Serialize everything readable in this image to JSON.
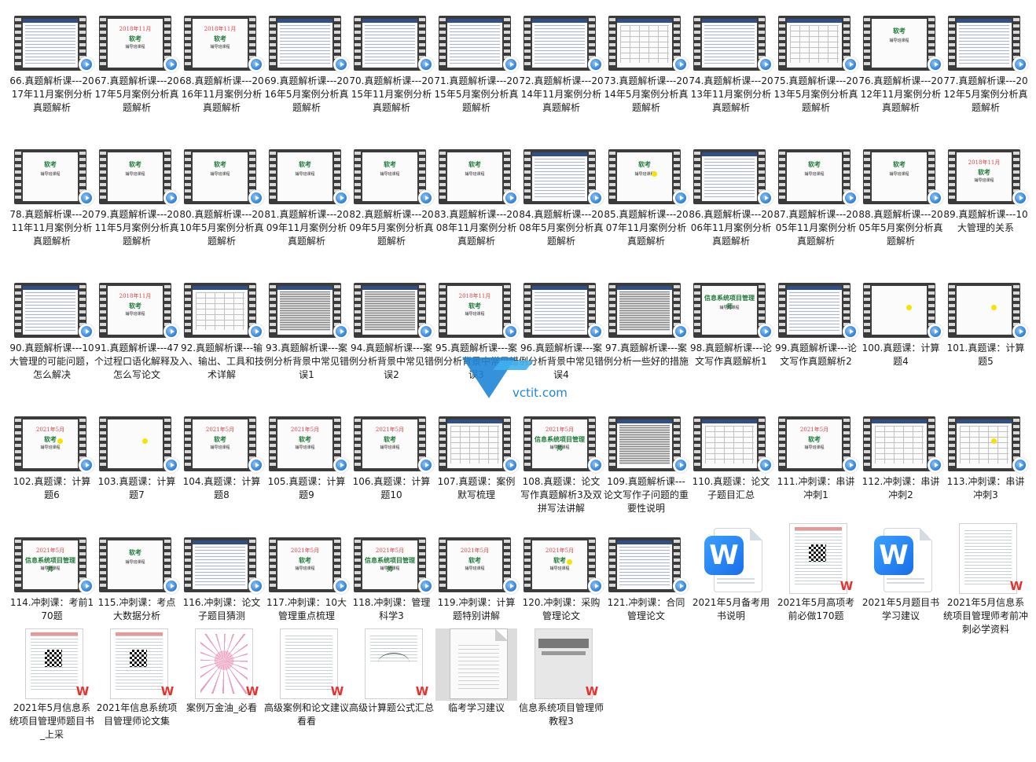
{
  "items": [
    {
      "label": "66.真题解析课---2017年11月案例分析真题解析",
      "thumb": "video",
      "screen": "lines"
    },
    {
      "label": "67.真题解析课---2017年5月案例分析真题解析",
      "thumb": "video",
      "screen": "title",
      "red": "2018年11月",
      "green": "软考",
      "small": "辅导班课程"
    },
    {
      "label": "68.真题解析课---2016年11月案例分析真题解析",
      "thumb": "video",
      "screen": "title",
      "red": "2018年11月",
      "green": "软考",
      "small": "辅导班课程"
    },
    {
      "label": "69.真题解析课---2016年5月案例分析真题解析",
      "thumb": "video",
      "screen": "lines"
    },
    {
      "label": "70.真题解析课---2015年11月案例分析真题解析",
      "thumb": "video",
      "screen": "lines"
    },
    {
      "label": "71.真题解析课---2015年5月案例分析真题解析",
      "thumb": "video",
      "screen": "lines"
    },
    {
      "label": "72.真题解析课---2014年11月案例分析真题解析",
      "thumb": "video",
      "screen": "lines"
    },
    {
      "label": "73.真题解析课---2014年5月案例分析真题解析",
      "thumb": "video",
      "screen": "table"
    },
    {
      "label": "74.真题解析课---2013年11月案例分析真题解析",
      "thumb": "video",
      "screen": "lines"
    },
    {
      "label": "75.真题解析课---2013年5月案例分析真题解析",
      "thumb": "video",
      "screen": "table"
    },
    {
      "label": "76.真题解析课---2012年11月案例分析真题解析",
      "thumb": "video",
      "screen": "title",
      "green": "软考",
      "small": "辅导班课程"
    },
    {
      "label": "77.真题解析课---2012年5月案例分析真题解析",
      "thumb": "video",
      "screen": "lines"
    },
    {
      "label": "78.真题解析课---2011年11月案例分析真题解析",
      "thumb": "video",
      "screen": "title",
      "green": "软考",
      "small": "辅导班课程"
    },
    {
      "label": "79.真题解析课---2011年5月案例分析真题解析",
      "thumb": "video",
      "screen": "title",
      "green": "软考",
      "small": "辅导班课程"
    },
    {
      "label": "80.真题解析课---2010年5月案例分析真题解析",
      "thumb": "video",
      "screen": "title",
      "green": "软考",
      "small": "辅导班课程"
    },
    {
      "label": "81.真题解析课---2009年11月案例分析真题解析",
      "thumb": "video",
      "screen": "title",
      "green": "软考",
      "small": "辅导班课程"
    },
    {
      "label": "82.真题解析课---2009年5月案例分析真题解析",
      "thumb": "video",
      "screen": "title",
      "green": "软考",
      "small": "辅导班课程"
    },
    {
      "label": "83.真题解析课---2008年11月案例分析真题解析",
      "thumb": "video",
      "screen": "title",
      "green": "软考",
      "small": "辅导班课程"
    },
    {
      "label": "84.真题解析课---2008年5月案例分析真题解析",
      "thumb": "video",
      "screen": "lines"
    },
    {
      "label": "85.真题解析课---2007年11月案例分析真题解析",
      "thumb": "video",
      "screen": "title",
      "green": "软考",
      "small": "辅导班课程",
      "dot": true
    },
    {
      "label": "86.真题解析课---2006年11月案例分析真题解析",
      "thumb": "video",
      "screen": "lines"
    },
    {
      "label": "87.真题解析课---2005年11月案例分析真题解析",
      "thumb": "video",
      "screen": "title",
      "green": "软考",
      "small": "辅导班课程"
    },
    {
      "label": "88.真题解析课---2005年5月案例分析真题解析",
      "thumb": "video",
      "screen": "title",
      "green": "软考",
      "small": "辅导班课程"
    },
    {
      "label": "89.真题解析课---10大管理的关系",
      "thumb": "video",
      "screen": "title",
      "red": "2018年11月",
      "green": "软考",
      "small": "辅导班课程"
    },
    {
      "label": "90.真题解析课---10大管理的可能问题，怎么解决",
      "thumb": "video",
      "screen": "lines"
    },
    {
      "label": "91.真题解析课---47个过程口语化解释及怎么写论文",
      "thumb": "video",
      "screen": "title",
      "red": "2018年11月",
      "green": "软考",
      "small": "辅导班课程"
    },
    {
      "label": "92.真题解析课---输入、输出、工具和技术详解",
      "thumb": "video",
      "screen": "table"
    },
    {
      "label": "93.真题解析课---案例分析背景中常见错误1",
      "thumb": "video",
      "screen": "dark"
    },
    {
      "label": "94.真题解析课---案例分析背景中常见错误2",
      "thumb": "video",
      "screen": "dark"
    },
    {
      "label": "95.真题解析课---案例分析背景中常见错误3",
      "thumb": "video",
      "screen": "title",
      "red": "2018年11月",
      "green": "软考",
      "small": "辅导班课程"
    },
    {
      "label": "96.真题解析课---案例分析背景中常见错误4",
      "thumb": "video",
      "screen": "lines"
    },
    {
      "label": "97.真题解析课---案例分析一些好的措施",
      "thumb": "video",
      "screen": "dark"
    },
    {
      "label": "98.真题解析课---论文写作真题解析1",
      "thumb": "video",
      "screen": "title",
      "green": "信息系统项目管理师",
      "small": "辅导班课程"
    },
    {
      "label": "99.真题解析课---论文写作真题解析2",
      "thumb": "video",
      "screen": "lines"
    },
    {
      "label": "100.真题课：计算题4",
      "thumb": "video",
      "screen": "blank",
      "dot": true
    },
    {
      "label": "101.真题课：计算题5",
      "thumb": "video",
      "screen": "blank",
      "dot": true
    },
    {
      "label": "102.真题课：计算题6",
      "thumb": "video",
      "screen": "title",
      "red": "2021年5月",
      "green": "软考",
      "small": "辅导班课程",
      "dot": true
    },
    {
      "label": "103.真题课：计算题7",
      "thumb": "video",
      "screen": "blank",
      "dot": true
    },
    {
      "label": "104.真题课：计算题8",
      "thumb": "video",
      "screen": "title",
      "red": "2021年5月",
      "green": "软考",
      "small": "辅导班课程"
    },
    {
      "label": "105.真题课：计算题9",
      "thumb": "video",
      "screen": "title",
      "red": "2021年5月",
      "green": "软考",
      "small": "辅导班课程"
    },
    {
      "label": "106.真题课：计算题10",
      "thumb": "video",
      "screen": "title",
      "red": "2021年5月",
      "green": "软考",
      "small": "辅导班课程"
    },
    {
      "label": "107.真题课：案例默写梳理",
      "thumb": "video",
      "screen": "table"
    },
    {
      "label": "108.真题课：论文写作真题解析3及双拼写法讲解",
      "thumb": "video",
      "screen": "title",
      "red": "2021年5月",
      "green": "信息系统项目管理师",
      "small": "辅导班课程"
    },
    {
      "label": "109.真题解析课---论文写作子问题的重要性说明",
      "thumb": "video",
      "screen": "dark"
    },
    {
      "label": "110.真题课：论文子题目汇总",
      "thumb": "video",
      "screen": "table"
    },
    {
      "label": "111.冲刺课：串讲冲刺1",
      "thumb": "video",
      "screen": "title",
      "red": "2021年5月",
      "green": "软考",
      "small": "辅导班课程"
    },
    {
      "label": "112.冲刺课：串讲冲刺2",
      "thumb": "video",
      "screen": "table"
    },
    {
      "label": "113.冲刺课：串讲冲刺3",
      "thumb": "video",
      "screen": "table",
      "dot": true
    },
    {
      "label": "114.冲刺课：考前170题",
      "thumb": "video",
      "screen": "title",
      "red": "2021年5月",
      "green": "信息系统项目管理师",
      "small": "辅导班课程"
    },
    {
      "label": "115.冲刺课：考点大数据分析",
      "thumb": "video",
      "screen": "title",
      "green": "软考",
      "small": "辅导班课程"
    },
    {
      "label": "116.冲刺课：论文子题目猜测",
      "thumb": "video",
      "screen": "lines"
    },
    {
      "label": "117.冲刺课：10大管理重点梳理",
      "thumb": "video",
      "screen": "title",
      "red": "2021年5月",
      "green": "软考",
      "small": "辅导班课程"
    },
    {
      "label": "118.冲刺课：管理科学3",
      "thumb": "video",
      "screen": "title",
      "red": "2021年5月",
      "green": "信息系统项目管理师",
      "small": "辅导班课程"
    },
    {
      "label": "119.冲刺课：计算题特别讲解",
      "thumb": "video",
      "screen": "title",
      "red": "2021年5月",
      "green": "软考",
      "small": "辅导班课程"
    },
    {
      "label": "120.冲刺课：采购管理论文",
      "thumb": "video",
      "screen": "title",
      "red": "2021年5月",
      "green": "软考",
      "small": "辅导班课程",
      "dot": true
    },
    {
      "label": "121.冲刺课：合同管理论文",
      "thumb": "video",
      "screen": "lines"
    },
    {
      "label": "2021年5月备考用书说明",
      "thumb": "word",
      "glyph": "W"
    },
    {
      "label": "2021年5月高项考前必做170题",
      "thumb": "doc",
      "kind": "qr"
    },
    {
      "label": "2021年5月题目书学习建议",
      "thumb": "word",
      "glyph": "W"
    },
    {
      "label": "2021年5月信息系统项目管理师考前冲刺必学资料",
      "thumb": "doc",
      "kind": "text"
    },
    {
      "label": "2021年5月信息系统项目管理师题目书_上采",
      "thumb": "doc",
      "kind": "qr"
    },
    {
      "label": "2021年信息系统项目管理师论文集",
      "thumb": "doc",
      "kind": "qr"
    },
    {
      "label": "案例万金油_必看",
      "thumb": "doc",
      "kind": "map"
    },
    {
      "label": "高级案例和论文建议看看",
      "thumb": "doc",
      "kind": "text"
    },
    {
      "label": "高级计算题公式汇总",
      "thumb": "doc",
      "kind": "curve"
    },
    {
      "label": "临考学习建议",
      "thumb": "doc",
      "kind": "plain",
      "selected": true
    },
    {
      "label": "信息系统项目管理师教程3",
      "thumb": "doc",
      "kind": "book"
    }
  ],
  "badges": {
    "wps": "W"
  },
  "watermark": {
    "text": "vctit.com"
  },
  "colors": {
    "film": "#3b3b3b",
    "play": "#2b7ed8",
    "wps_red": "#e8312f",
    "word_blue": "#1a6fe8",
    "watermark_blue": "#1f86d6"
  }
}
